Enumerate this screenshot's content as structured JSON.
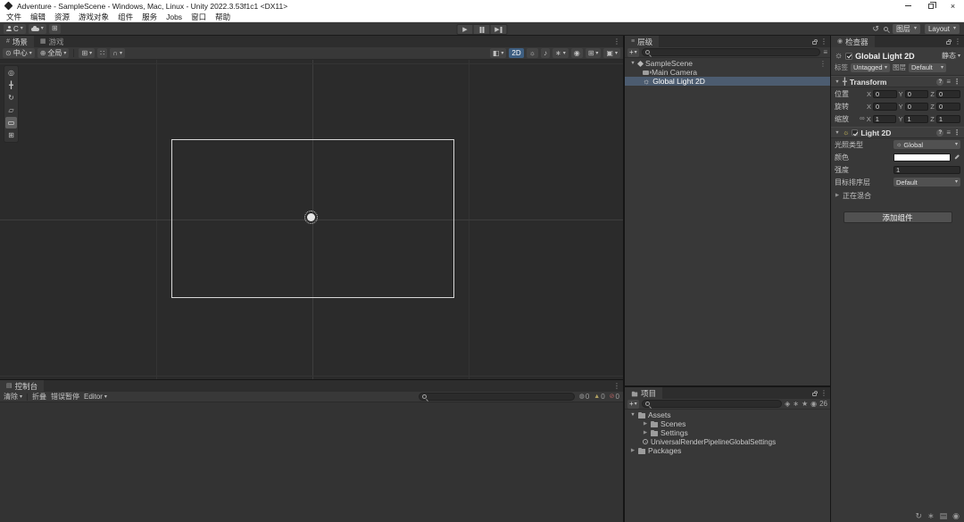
{
  "window": {
    "title": "Adventure - SampleScene - Windows, Mac, Linux - Unity 2022.3.53f1c1 <DX11>"
  },
  "menu": {
    "items": [
      "文件",
      "编辑",
      "资源",
      "游戏对象",
      "组件",
      "服务",
      "Jobs",
      "窗口",
      "帮助"
    ]
  },
  "toolbar": {
    "account": "C",
    "layers": "图层",
    "layout": "Layout"
  },
  "scene_panel": {
    "tab_scene": "场景",
    "tab_game": "游戏",
    "pivot": "中心",
    "orientation": "全局",
    "mode_2d": "2D"
  },
  "hierarchy": {
    "tab": "层级",
    "items": [
      {
        "label": "SampleScene"
      },
      {
        "label": "Main Camera"
      },
      {
        "label": "Global Light 2D"
      }
    ]
  },
  "project": {
    "tab": "项目",
    "hidden_count": "26",
    "items": [
      {
        "label": "Assets"
      },
      {
        "label": "Scenes"
      },
      {
        "label": "Settings"
      },
      {
        "label": "UniversalRenderPipelineGlobalSettings"
      },
      {
        "label": "Packages"
      }
    ]
  },
  "console": {
    "tab": "控制台",
    "clear": "清除",
    "collapse": "折叠",
    "error_pause": "错误暂停",
    "editor": "Editor",
    "info_count": "0",
    "warn_count": "0",
    "error_count": "0"
  },
  "inspector": {
    "tab": "检查器",
    "name": "Global Light 2D",
    "static": "静态",
    "tag_label": "标签",
    "tag_value": "Untagged",
    "layer_label": "图层",
    "layer_value": "Default",
    "axis": {
      "x": "X",
      "y": "Y",
      "z": "Z"
    },
    "transform": {
      "title": "Transform",
      "position": {
        "label": "位置",
        "x": "0",
        "y": "0",
        "z": "0"
      },
      "rotation": {
        "label": "旋转",
        "x": "0",
        "y": "0",
        "z": "0"
      },
      "scale": {
        "label": "缩放",
        "x": "1",
        "y": "1",
        "z": "1"
      }
    },
    "light": {
      "title": "Light 2D",
      "type_label": "光照类型",
      "type_value": "Global",
      "color_label": "颜色",
      "color_value": "#FFFFFF",
      "intensity_label": "强度",
      "intensity_value": "1",
      "sorting_label": "目标排序层",
      "sorting_value": "Default",
      "blending_label": "正在混合"
    },
    "add_component": "添加组件"
  },
  "colors": {
    "selection": "#4C5C70",
    "viewport_bg": "#2B2B2B",
    "camera_outline": "#D8D8D8"
  }
}
